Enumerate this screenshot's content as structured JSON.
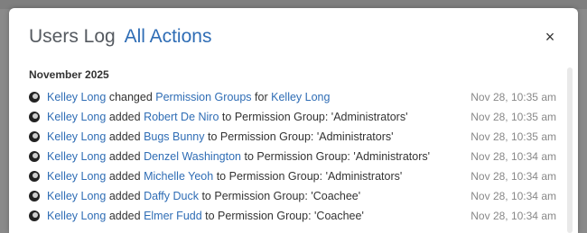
{
  "header": {
    "title_prefix": "Users Log",
    "title_highlight": "All Actions",
    "close_glyph": "×"
  },
  "log": {
    "month": "November 2025",
    "entries": [
      {
        "actor": "Kelley Long",
        "verb": "changed",
        "object": "Permission Groups",
        "suffix": "for",
        "target": "Kelley Long",
        "time": "Nov 28, 10:35 am"
      },
      {
        "actor": "Kelley Long",
        "verb": "added",
        "object": "Robert De Niro",
        "suffix": "to Permission Group: 'Administrators'",
        "target": "",
        "time": "Nov 28, 10:35 am"
      },
      {
        "actor": "Kelley Long",
        "verb": "added",
        "object": "Bugs Bunny",
        "suffix": "to Permission Group: 'Administrators'",
        "target": "",
        "time": "Nov 28, 10:35 am"
      },
      {
        "actor": "Kelley Long",
        "verb": "added",
        "object": "Denzel Washington",
        "suffix": "to Permission Group: 'Administrators'",
        "target": "",
        "time": "Nov 28, 10:34 am"
      },
      {
        "actor": "Kelley Long",
        "verb": "added",
        "object": "Michelle Yeoh",
        "suffix": "to Permission Group: 'Administrators'",
        "target": "",
        "time": "Nov 28, 10:34 am"
      },
      {
        "actor": "Kelley Long",
        "verb": "added",
        "object": "Daffy Duck",
        "suffix": "to Permission Group: 'Coachee'",
        "target": "",
        "time": "Nov 28, 10:34 am"
      },
      {
        "actor": "Kelley Long",
        "verb": "added",
        "object": "Elmer Fudd",
        "suffix": "to Permission Group: 'Coachee'",
        "target": "",
        "time": "Nov 28, 10:34 am"
      }
    ]
  }
}
